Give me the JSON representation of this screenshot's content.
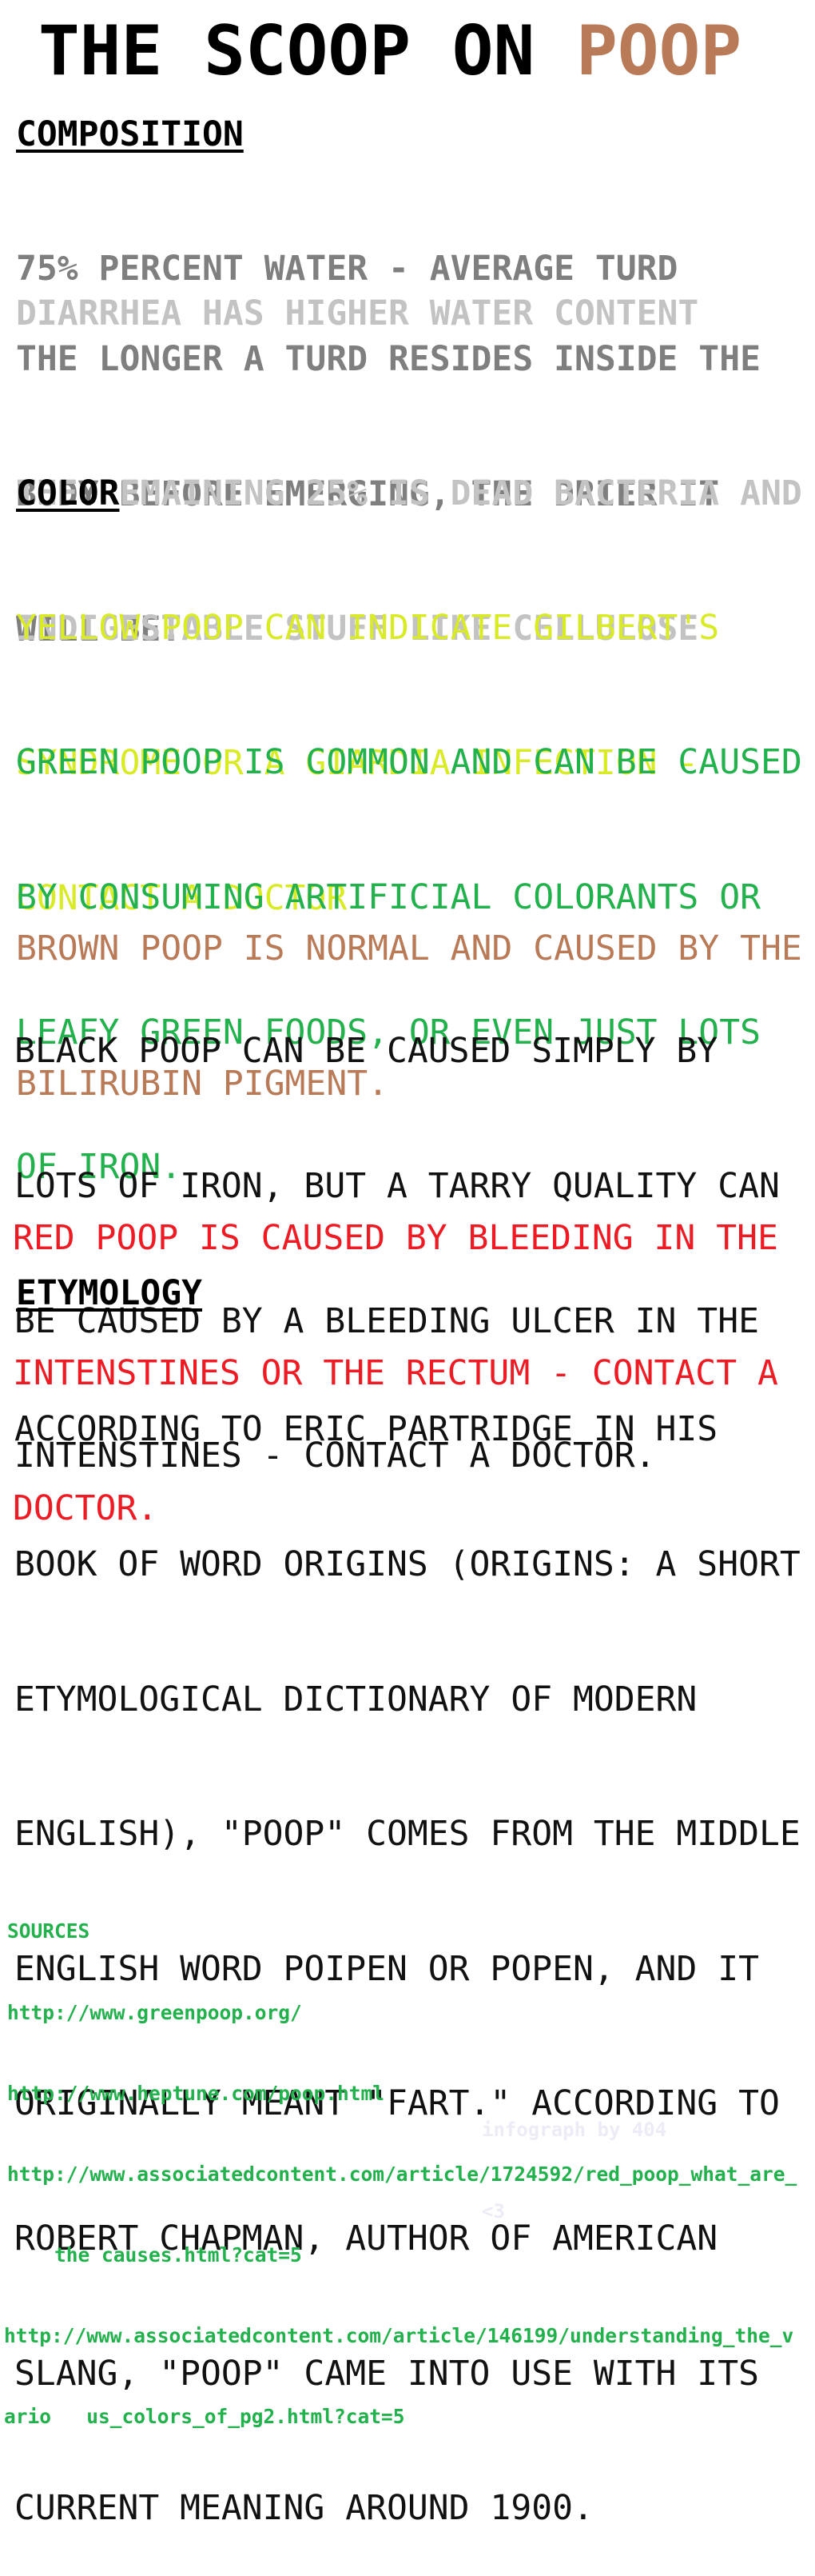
{
  "title": {
    "part1": "THE SCOOP ON ",
    "part2": "POOP"
  },
  "colors": {
    "poop_brown": "#b97a57",
    "gray": "#7f7f7f",
    "light_gray": "#c3c3c3",
    "yellow": "#d9ea26",
    "green": "#22b14c",
    "red": "#ed1c24",
    "black": "#111111"
  },
  "composition": {
    "heading": "COMPOSITION",
    "paragraphs": [
      {
        "lines": [
          "75% PERCENT WATER - AVERAGE TURD"
        ]
      },
      {
        "lines": [
          "DIARRHEA HAS HIGHER WATER CONTENT"
        ]
      },
      {
        "lines": [
          "THE LONGER A TURD RESIDES INSIDE THE",
          "BODY BEFORE EMERGING, THE DRIER IT",
          "WILL BE."
        ]
      },
      {
        "lines": [
          "THE REMAINING 25% IS DEAD BACTERIA AND",
          "INDIGESTABLE STUFF LIKE CELLULOSE"
        ]
      }
    ]
  },
  "color": {
    "heading": "COLOR",
    "paragraphs": [
      {
        "lines": [
          "YELLOW POOP CAN INDICATE GILBERT'S",
          "SYNDROME OR A GIARDIA INFECTION -",
          "CONTACT A DOCTOR"
        ]
      },
      {
        "lines": [
          "GREEN POOP IS COMMON AND CAN BE CAUSED",
          "BY CONSUMING ARTIFICIAL COLORANTS OR",
          "LEAFY GREEN FOODS, OR EVEN JUST LOTS",
          "OF IRON."
        ]
      },
      {
        "lines": [
          "BROWN POOP IS NORMAL AND CAUSED BY THE",
          "BILIRUBIN PIGMENT."
        ]
      },
      {
        "lines": [
          "BLACK POOP CAN BE CAUSED SIMPLY BY",
          "LOTS OF IRON, BUT A TARRY QUALITY CAN",
          "BE CAUSED BY A BLEEDING ULCER IN THE",
          "INTENSTINES - CONTACT A DOCTOR."
        ]
      },
      {
        "lines": [
          "RED POOP IS CAUSED BY BLEEDING IN THE",
          "INTENSTINES OR THE RECTUM - CONTACT A",
          "DOCTOR."
        ]
      }
    ]
  },
  "etymology": {
    "heading": "ETYMOLOGY",
    "lines": [
      "ACCORDING TO ERIC PARTRIDGE IN HIS",
      "BOOK OF WORD ORIGINS (ORIGINS: A SHORT",
      "ETYMOLOGICAL DICTIONARY OF MODERN",
      "ENGLISH), \"POOP\" COMES FROM THE MIDDLE",
      "ENGLISH WORD POIPEN OR POPEN, AND IT",
      "ORIGINALLY MEANT \"FART.\" ACCORDING TO",
      "ROBERT CHAPMAN, AUTHOR OF AMERICAN",
      "SLANG, \"POOP\" CAME INTO USE WITH ITS",
      "CURRENT MEANING AROUND 1900."
    ]
  },
  "sources": {
    "heading": "SOURCES",
    "lines": [
      "http://www.greenpoop.org/",
      "http://www.heptune.com/poop.html",
      "http://www.associatedcontent.com/article/1724592/red_poop_what_are_",
      "    the causes.html?cat=5",
      "http://www.associatedcontent.com/article/146199/understanding_the_v",
      "ario   us_colors_of_pg2.html?cat=5"
    ]
  },
  "credit": {
    "line1": "infograph by 404",
    "line2": "<3"
  }
}
